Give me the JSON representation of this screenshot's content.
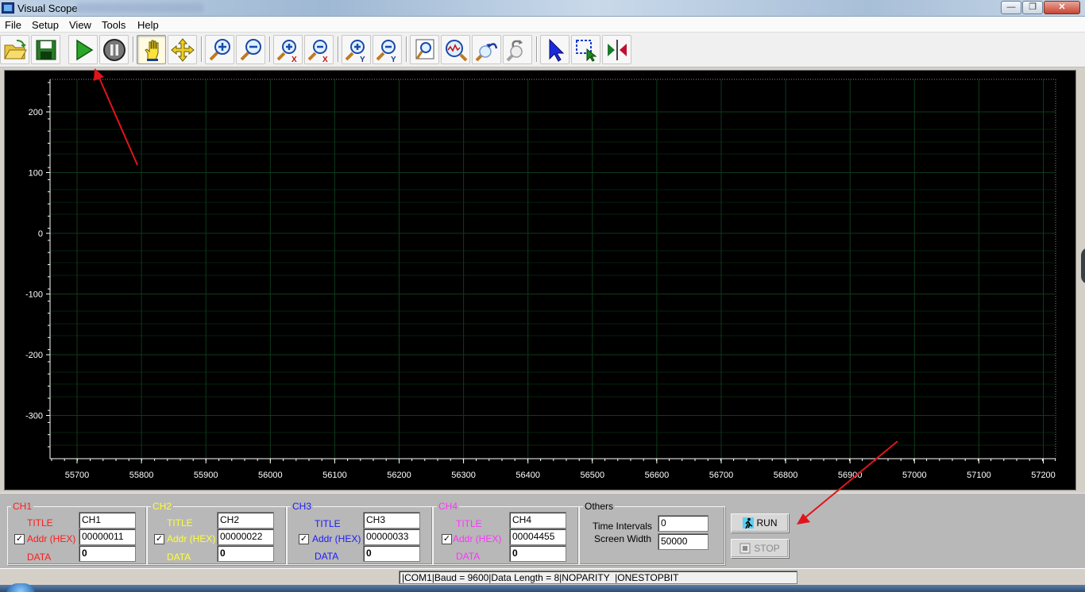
{
  "window": {
    "title": "Visual Scope"
  },
  "menu": {
    "items": [
      "File",
      "Setup",
      "View",
      "Tools",
      "Help"
    ]
  },
  "toolbar": {
    "buttons": [
      "open-icon",
      "save-icon",
      "run-icon",
      "pause-icon",
      "hand-icon",
      "move-icon",
      "zoom-in-icon",
      "zoom-out-icon",
      "zoom-in-x-icon",
      "zoom-out-x-icon",
      "zoom-in-y-icon",
      "zoom-out-y-icon",
      "zoom-fit-icon",
      "zoom-auto-icon",
      "zoom-undo-icon",
      "zoom-redo-icon",
      "pointer-icon",
      "region-select-icon",
      "cursor-measure-icon"
    ],
    "pressed": [
      "hand-icon"
    ]
  },
  "scope": {
    "y_ticks": [
      "200",
      "100",
      "0",
      "-100",
      "-200",
      "-300"
    ],
    "x_ticks": [
      "55700",
      "55800",
      "55900",
      "56000",
      "56100",
      "56200",
      "56300",
      "56400",
      "56500",
      "56600",
      "56700",
      "56800",
      "56900",
      "57000",
      "57100",
      "57200"
    ],
    "background": "#000000",
    "grid_color": "#0f3a1a",
    "axis_color": "#ffffff"
  },
  "channels": [
    {
      "legend": "CH1",
      "color": "#ff1a1a",
      "title_label": "TITLE",
      "addr_label": "Addr (HEX)",
      "data_label": "DATA",
      "title_value": "CH1",
      "addr_value": "00000011",
      "data_value": "0",
      "checked": true
    },
    {
      "legend": "CH2",
      "color": "#ffff33",
      "title_label": "TITLE",
      "addr_label": "Addr (HEX)",
      "data_label": "DATA",
      "title_value": "CH2",
      "addr_value": "00000022",
      "data_value": "0",
      "checked": true
    },
    {
      "legend": "CH3",
      "color": "#1a1aff",
      "title_label": "TITLE",
      "addr_label": "Addr (HEX)",
      "data_label": "DATA",
      "title_value": "CH3",
      "addr_value": "00000033",
      "data_value": "0",
      "checked": true
    },
    {
      "legend": "CH4",
      "color": "#ff33ff",
      "title_label": "TITLE",
      "addr_label": "Addr (HEX)",
      "data_label": "DATA",
      "title_value": "CH4",
      "addr_value": "00004455",
      "data_value": "0",
      "checked": true
    }
  ],
  "others": {
    "legend": "Others",
    "time_intervals_label": "Time Intervals",
    "time_intervals_value": "0",
    "screen_width_label": "Screen Width",
    "screen_width_value": "50000"
  },
  "controls": {
    "run_label": "RUN",
    "stop_label": "STOP"
  },
  "status": {
    "text": "|COM1|Baud = 9600|Data Length = 8|NOPARITY  |ONESTOPBIT"
  },
  "colors": {
    "annotation_arrow": "#e0151b"
  }
}
